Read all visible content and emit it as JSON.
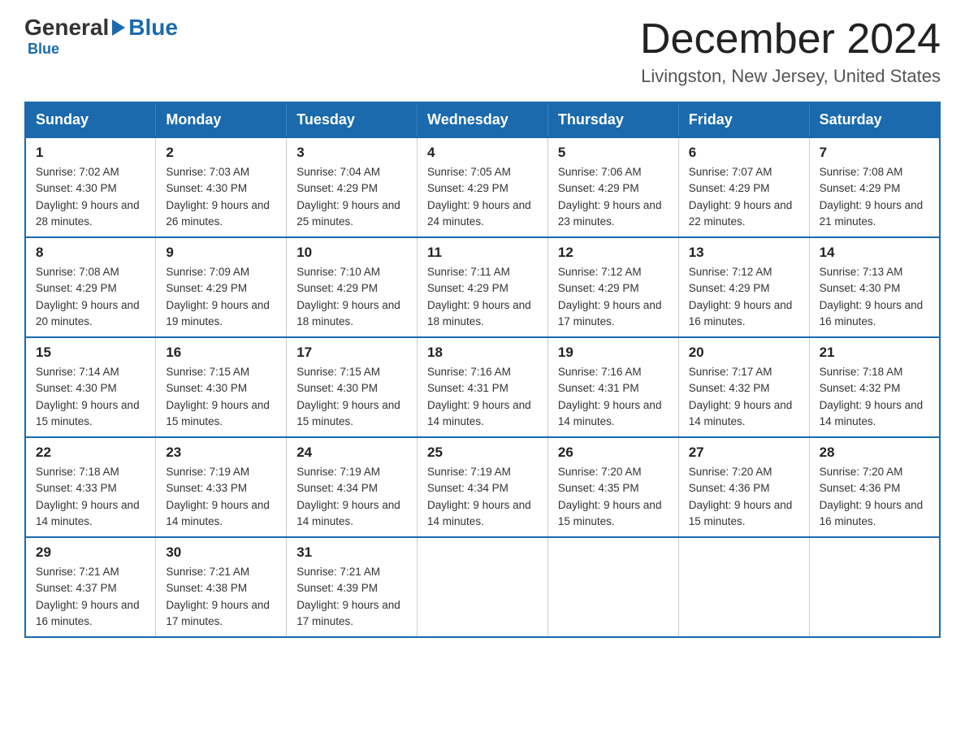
{
  "logo": {
    "general": "General",
    "blue": "Blue",
    "subtitle": "Blue"
  },
  "header": {
    "title": "December 2024",
    "subtitle": "Livingston, New Jersey, United States"
  },
  "days_of_week": [
    "Sunday",
    "Monday",
    "Tuesday",
    "Wednesday",
    "Thursday",
    "Friday",
    "Saturday"
  ],
  "weeks": [
    [
      {
        "day": "1",
        "sunrise": "7:02 AM",
        "sunset": "4:30 PM",
        "daylight": "9 hours and 28 minutes."
      },
      {
        "day": "2",
        "sunrise": "7:03 AM",
        "sunset": "4:30 PM",
        "daylight": "9 hours and 26 minutes."
      },
      {
        "day": "3",
        "sunrise": "7:04 AM",
        "sunset": "4:29 PM",
        "daylight": "9 hours and 25 minutes."
      },
      {
        "day": "4",
        "sunrise": "7:05 AM",
        "sunset": "4:29 PM",
        "daylight": "9 hours and 24 minutes."
      },
      {
        "day": "5",
        "sunrise": "7:06 AM",
        "sunset": "4:29 PM",
        "daylight": "9 hours and 23 minutes."
      },
      {
        "day": "6",
        "sunrise": "7:07 AM",
        "sunset": "4:29 PM",
        "daylight": "9 hours and 22 minutes."
      },
      {
        "day": "7",
        "sunrise": "7:08 AM",
        "sunset": "4:29 PM",
        "daylight": "9 hours and 21 minutes."
      }
    ],
    [
      {
        "day": "8",
        "sunrise": "7:08 AM",
        "sunset": "4:29 PM",
        "daylight": "9 hours and 20 minutes."
      },
      {
        "day": "9",
        "sunrise": "7:09 AM",
        "sunset": "4:29 PM",
        "daylight": "9 hours and 19 minutes."
      },
      {
        "day": "10",
        "sunrise": "7:10 AM",
        "sunset": "4:29 PM",
        "daylight": "9 hours and 18 minutes."
      },
      {
        "day": "11",
        "sunrise": "7:11 AM",
        "sunset": "4:29 PM",
        "daylight": "9 hours and 18 minutes."
      },
      {
        "day": "12",
        "sunrise": "7:12 AM",
        "sunset": "4:29 PM",
        "daylight": "9 hours and 17 minutes."
      },
      {
        "day": "13",
        "sunrise": "7:12 AM",
        "sunset": "4:29 PM",
        "daylight": "9 hours and 16 minutes."
      },
      {
        "day": "14",
        "sunrise": "7:13 AM",
        "sunset": "4:30 PM",
        "daylight": "9 hours and 16 minutes."
      }
    ],
    [
      {
        "day": "15",
        "sunrise": "7:14 AM",
        "sunset": "4:30 PM",
        "daylight": "9 hours and 15 minutes."
      },
      {
        "day": "16",
        "sunrise": "7:15 AM",
        "sunset": "4:30 PM",
        "daylight": "9 hours and 15 minutes."
      },
      {
        "day": "17",
        "sunrise": "7:15 AM",
        "sunset": "4:30 PM",
        "daylight": "9 hours and 15 minutes."
      },
      {
        "day": "18",
        "sunrise": "7:16 AM",
        "sunset": "4:31 PM",
        "daylight": "9 hours and 14 minutes."
      },
      {
        "day": "19",
        "sunrise": "7:16 AM",
        "sunset": "4:31 PM",
        "daylight": "9 hours and 14 minutes."
      },
      {
        "day": "20",
        "sunrise": "7:17 AM",
        "sunset": "4:32 PM",
        "daylight": "9 hours and 14 minutes."
      },
      {
        "day": "21",
        "sunrise": "7:18 AM",
        "sunset": "4:32 PM",
        "daylight": "9 hours and 14 minutes."
      }
    ],
    [
      {
        "day": "22",
        "sunrise": "7:18 AM",
        "sunset": "4:33 PM",
        "daylight": "9 hours and 14 minutes."
      },
      {
        "day": "23",
        "sunrise": "7:19 AM",
        "sunset": "4:33 PM",
        "daylight": "9 hours and 14 minutes."
      },
      {
        "day": "24",
        "sunrise": "7:19 AM",
        "sunset": "4:34 PM",
        "daylight": "9 hours and 14 minutes."
      },
      {
        "day": "25",
        "sunrise": "7:19 AM",
        "sunset": "4:34 PM",
        "daylight": "9 hours and 14 minutes."
      },
      {
        "day": "26",
        "sunrise": "7:20 AM",
        "sunset": "4:35 PM",
        "daylight": "9 hours and 15 minutes."
      },
      {
        "day": "27",
        "sunrise": "7:20 AM",
        "sunset": "4:36 PM",
        "daylight": "9 hours and 15 minutes."
      },
      {
        "day": "28",
        "sunrise": "7:20 AM",
        "sunset": "4:36 PM",
        "daylight": "9 hours and 16 minutes."
      }
    ],
    [
      {
        "day": "29",
        "sunrise": "7:21 AM",
        "sunset": "4:37 PM",
        "daylight": "9 hours and 16 minutes."
      },
      {
        "day": "30",
        "sunrise": "7:21 AM",
        "sunset": "4:38 PM",
        "daylight": "9 hours and 17 minutes."
      },
      {
        "day": "31",
        "sunrise": "7:21 AM",
        "sunset": "4:39 PM",
        "daylight": "9 hours and 17 minutes."
      },
      null,
      null,
      null,
      null
    ]
  ],
  "labels": {
    "sunrise_prefix": "Sunrise: ",
    "sunset_prefix": "Sunset: ",
    "daylight_prefix": "Daylight: "
  }
}
